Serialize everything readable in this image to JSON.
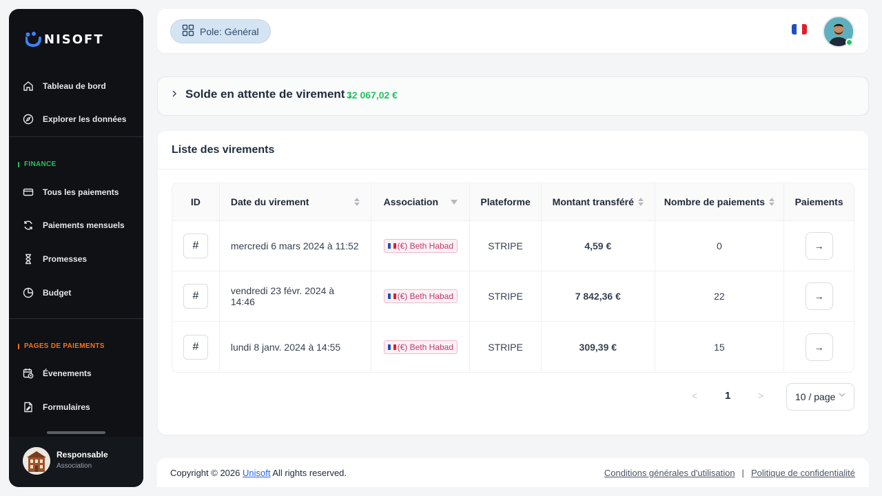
{
  "brand": {
    "name": "NISOFT"
  },
  "sidebar": {
    "items_top": [
      {
        "label": "Tableau de bord",
        "icon": "home-icon"
      },
      {
        "label": "Explorer les données",
        "icon": "compass-icon"
      }
    ],
    "finance_label": "FINANCE",
    "finance_color": "#22c55e",
    "finance_items": [
      {
        "label": "Tous les paiements",
        "icon": "card-icon"
      },
      {
        "label": "Paiements mensuels",
        "icon": "refresh-icon"
      },
      {
        "label": "Promesses",
        "icon": "hourglass-icon"
      },
      {
        "label": "Budget",
        "icon": "pie-chart-icon"
      }
    ],
    "pages_label": "PAGES DE PAIEMENTS",
    "pages_color": "#f97316",
    "pages_items": [
      {
        "label": "Évenements",
        "icon": "calendar-clock-icon"
      },
      {
        "label": "Formulaires",
        "icon": "form-icon"
      }
    ],
    "user": {
      "name": "Responsable",
      "role": "Association"
    }
  },
  "header": {
    "pole_label": "Pole: Général"
  },
  "balance": {
    "label": "Solde en attente de virement :",
    "amount": "32 067,02 €"
  },
  "transfers": {
    "title": "Liste des virements",
    "columns": [
      "ID",
      "Date du virement",
      "Association",
      "Plateforme",
      "Montant transféré",
      "Nombre de paiements",
      "Paiements"
    ],
    "rows": [
      {
        "id": "#",
        "date": "mercredi 6 mars 2024 à 11:52",
        "association": "(€) Beth Habad",
        "platform": "STRIPE",
        "amount": "4,59 €",
        "count": "0",
        "action": "→"
      },
      {
        "id": "#",
        "date": "vendredi 23 févr. 2024 à 14:46",
        "association": "(€) Beth Habad",
        "platform": "STRIPE",
        "amount": "7 842,36 €",
        "count": "22",
        "action": "→"
      },
      {
        "id": "#",
        "date": "lundi 8 janv. 2024 à 14:55",
        "association": "(€) Beth Habad",
        "platform": "STRIPE",
        "amount": "309,39 €",
        "count": "15",
        "action": "→"
      }
    ]
  },
  "pagination": {
    "prev": "<",
    "current": "1",
    "next": ">",
    "page_size": "10 / page"
  },
  "footer": {
    "copyright_prefix": "Copyright © 2026",
    "company": "Unisoft",
    "copyright_suffix": "All rights reserved.",
    "terms": "Conditions générales d'utilisation",
    "separator": "|",
    "privacy": "Politique de confidentialité"
  }
}
